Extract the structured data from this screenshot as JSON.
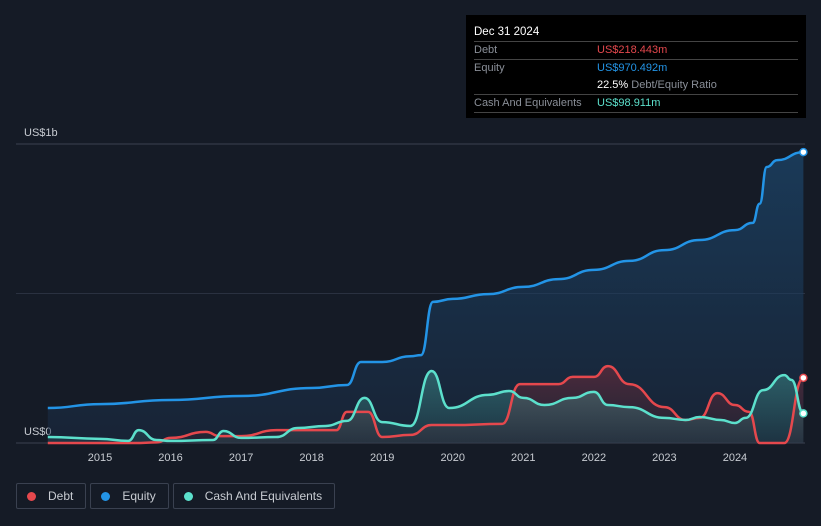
{
  "tooltip": {
    "date": "Dec 31 2024",
    "debt_label": "Debt",
    "debt_value": "US$218.443m",
    "equity_label": "Equity",
    "equity_value": "US$970.492m",
    "ratio_value": "22.5%",
    "ratio_label": "Debt/Equity Ratio",
    "cash_label": "Cash And Equivalents",
    "cash_value": "US$98.911m"
  },
  "legend": [
    {
      "label": "Debt",
      "color": "#e5484d"
    },
    {
      "label": "Equity",
      "color": "#2394e6"
    },
    {
      "label": "Cash And Equivalents",
      "color": "#5ce0cc"
    }
  ],
  "chart_data": {
    "type": "area",
    "y_ticks": [
      {
        "value": 0,
        "label": "US$0"
      },
      {
        "value": 1000,
        "label": "US$1b"
      }
    ],
    "ylim": [
      0,
      1000
    ],
    "y_unit": "US$ millions",
    "x_ticks": [
      "2015",
      "2016",
      "2017",
      "2018",
      "2019",
      "2020",
      "2021",
      "2022",
      "2023",
      "2024"
    ],
    "xlim": [
      2014.26,
      2025.0
    ],
    "grid": true,
    "series": [
      {
        "name": "Equity",
        "color": "#2394e6",
        "points": [
          [
            2014.26,
            117
          ],
          [
            2015,
            130
          ],
          [
            2016,
            144
          ],
          [
            2017,
            157
          ],
          [
            2018,
            184
          ],
          [
            2018.5,
            194
          ],
          [
            2018.7,
            271
          ],
          [
            2019,
            271
          ],
          [
            2019.4,
            290
          ],
          [
            2019.55,
            294
          ],
          [
            2019.72,
            472
          ],
          [
            2020,
            482
          ],
          [
            2020.5,
            498
          ],
          [
            2021,
            522
          ],
          [
            2021.5,
            548
          ],
          [
            2022,
            579
          ],
          [
            2022.5,
            609
          ],
          [
            2023,
            645
          ],
          [
            2023.5,
            679
          ],
          [
            2024,
            712
          ],
          [
            2024.25,
            736
          ],
          [
            2024.35,
            800
          ],
          [
            2024.45,
            923
          ],
          [
            2024.6,
            946
          ],
          [
            2024.97,
            973
          ]
        ]
      },
      {
        "name": "Debt",
        "color": "#e5484d",
        "points": [
          [
            2014.26,
            0
          ],
          [
            2015.5,
            0
          ],
          [
            2015.8,
            2
          ],
          [
            2016,
            17
          ],
          [
            2016.5,
            37
          ],
          [
            2016.7,
            23
          ],
          [
            2017,
            23
          ],
          [
            2017.5,
            43
          ],
          [
            2018,
            43
          ],
          [
            2018.35,
            43
          ],
          [
            2018.5,
            104
          ],
          [
            2018.8,
            104
          ],
          [
            2019,
            20
          ],
          [
            2019.4,
            27
          ],
          [
            2019.7,
            60
          ],
          [
            2020,
            60
          ],
          [
            2020.7,
            64
          ],
          [
            2020.95,
            197
          ],
          [
            2021.5,
            197
          ],
          [
            2021.7,
            221
          ],
          [
            2022,
            221
          ],
          [
            2022.2,
            257
          ],
          [
            2022.5,
            197
          ],
          [
            2023,
            120
          ],
          [
            2023.3,
            77
          ],
          [
            2023.5,
            84
          ],
          [
            2023.75,
            167
          ],
          [
            2024,
            127
          ],
          [
            2024.2,
            104
          ],
          [
            2024.35,
            0
          ],
          [
            2024.7,
            0
          ],
          [
            2024.97,
            218
          ]
        ]
      },
      {
        "name": "Cash And Equivalents",
        "color": "#5ce0cc",
        "points": [
          [
            2014.26,
            20
          ],
          [
            2015,
            14
          ],
          [
            2015.4,
            7
          ],
          [
            2015.55,
            43
          ],
          [
            2015.8,
            10
          ],
          [
            2016,
            7
          ],
          [
            2016.6,
            10
          ],
          [
            2016.75,
            40
          ],
          [
            2017,
            17
          ],
          [
            2017.5,
            20
          ],
          [
            2017.8,
            50
          ],
          [
            2018.2,
            57
          ],
          [
            2018.5,
            74
          ],
          [
            2018.75,
            151
          ],
          [
            2019,
            70
          ],
          [
            2019.4,
            57
          ],
          [
            2019.7,
            241
          ],
          [
            2019.95,
            117
          ],
          [
            2020.5,
            161
          ],
          [
            2020.8,
            174
          ],
          [
            2021,
            151
          ],
          [
            2021.3,
            127
          ],
          [
            2021.7,
            151
          ],
          [
            2022,
            171
          ],
          [
            2022.2,
            127
          ],
          [
            2022.5,
            120
          ],
          [
            2023,
            84
          ],
          [
            2023.3,
            77
          ],
          [
            2023.5,
            87
          ],
          [
            2023.8,
            77
          ],
          [
            2024,
            67
          ],
          [
            2024.15,
            84
          ],
          [
            2024.4,
            177
          ],
          [
            2024.7,
            227
          ],
          [
            2024.8,
            211
          ],
          [
            2024.97,
            99
          ]
        ]
      }
    ]
  }
}
